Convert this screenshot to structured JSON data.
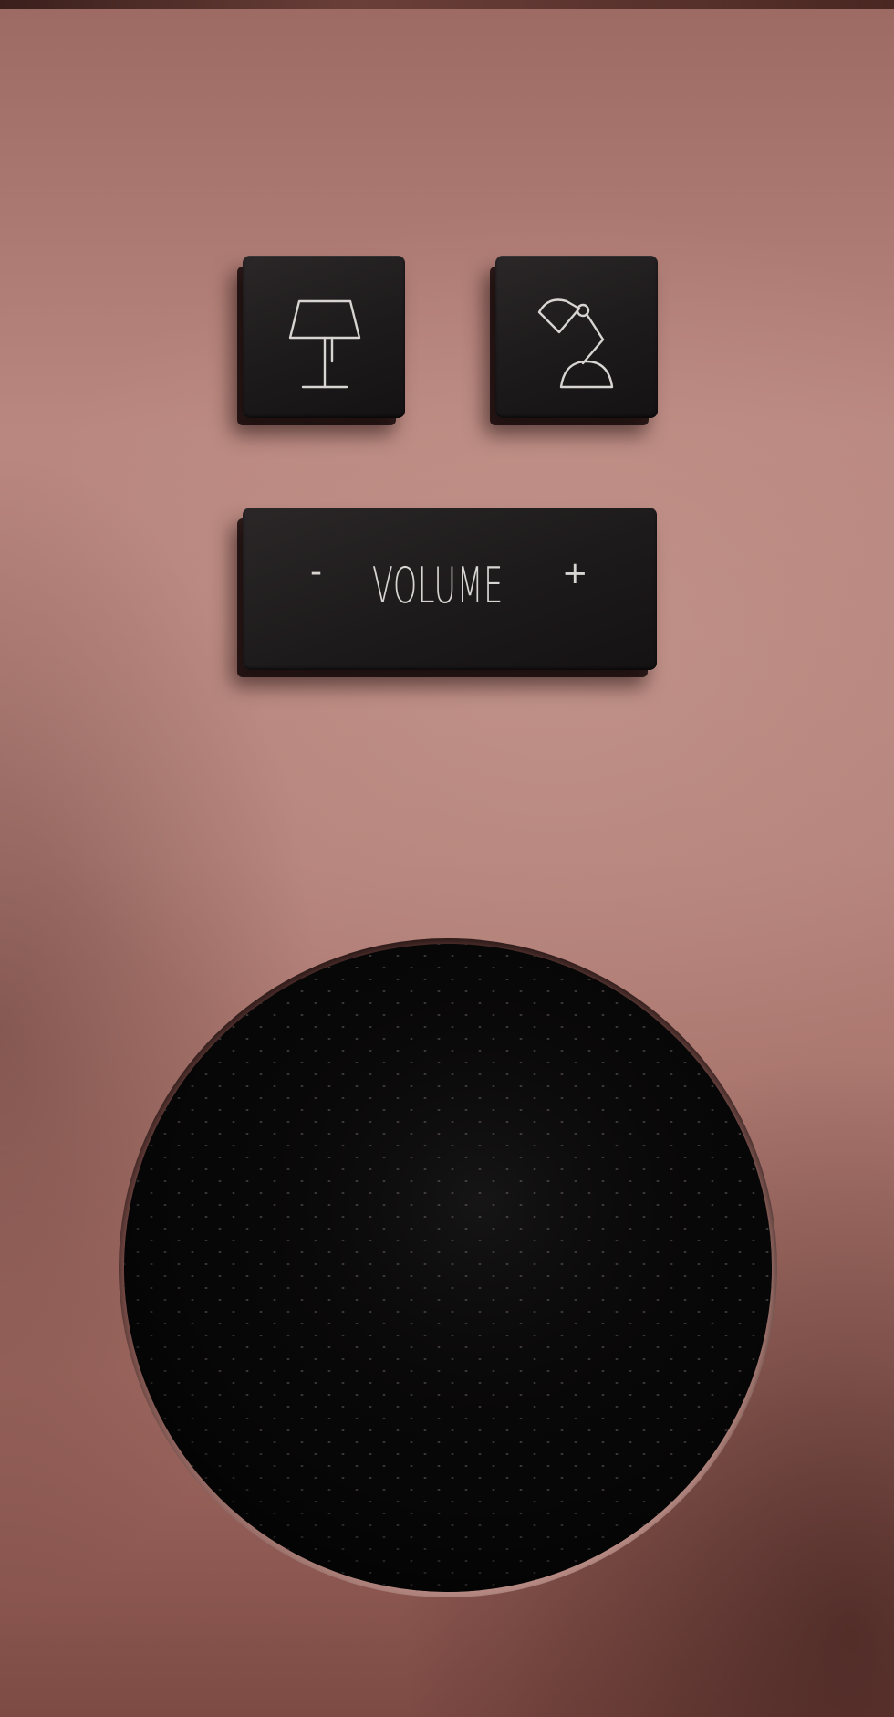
{
  "device": {
    "panel_color": "#b4827a",
    "key_color": "#1d1a1b",
    "label_color": "#d8d4d2"
  },
  "buttons": {
    "lamp1": {
      "icon": "table-lamp-icon"
    },
    "lamp2": {
      "icon": "desk-lamp-icon"
    },
    "volume": {
      "minus": "-",
      "label": "VOLUME",
      "plus": "+"
    }
  },
  "speaker": {
    "icon": "speaker-grille"
  }
}
